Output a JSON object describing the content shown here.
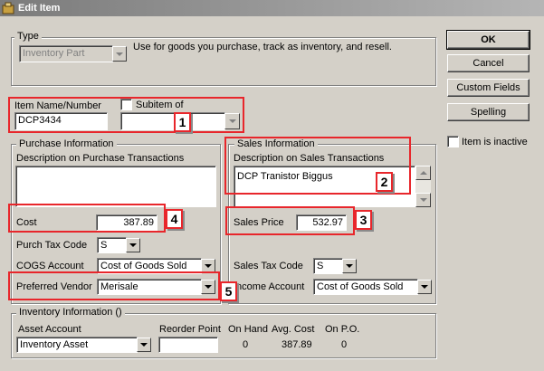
{
  "window": {
    "title": "Edit Item"
  },
  "type_section": {
    "legend": "Type",
    "selected": "Inventory Part",
    "description": "Use for goods you purchase, track as inventory, and resell."
  },
  "buttons": {
    "ok": "OK",
    "cancel": "Cancel",
    "custom_fields": "Custom Fields",
    "spelling": "Spelling"
  },
  "inactive": {
    "label": "Item is inactive",
    "checked": false
  },
  "item": {
    "name_label": "Item Name/Number",
    "name_value": "DCP3434",
    "subitem_label": "Subitem of",
    "subitem_value": ""
  },
  "purchase": {
    "legend": "Purchase Information",
    "desc_label": "Description on Purchase Transactions",
    "desc_value": "",
    "cost_label": "Cost",
    "cost_value": "387.89",
    "tax_label": "Purch Tax Code",
    "tax_value": "S",
    "cogs_label": "COGS Account",
    "cogs_value": "Cost of Goods Sold",
    "vendor_label": "Preferred Vendor",
    "vendor_value": "Merisale"
  },
  "sales": {
    "legend": "Sales Information",
    "desc_label": "Description on Sales Transactions",
    "desc_value": "DCP Tranistor Biggus",
    "price_label": "Sales Price",
    "price_value": "532.97",
    "tax_label": "Sales Tax Code",
    "tax_value": "S",
    "income_label": "Income Account",
    "income_value": "Cost of Goods Sold"
  },
  "inventory": {
    "legend": "Inventory Information ()",
    "asset_label": "Asset Account",
    "asset_value": "Inventory Asset",
    "reorder_label": "Reorder Point",
    "reorder_value": "",
    "onhand_label": "On Hand",
    "onhand_value": "0",
    "avgcost_label": "Avg. Cost",
    "avgcost_value": "387.89",
    "onpo_label": "On P.O.",
    "onpo_value": "0"
  },
  "callouts": [
    "1",
    "2",
    "3",
    "4",
    "5"
  ],
  "colors": {
    "callout": "#e8262b",
    "window_bg": "#d4d0c8"
  }
}
